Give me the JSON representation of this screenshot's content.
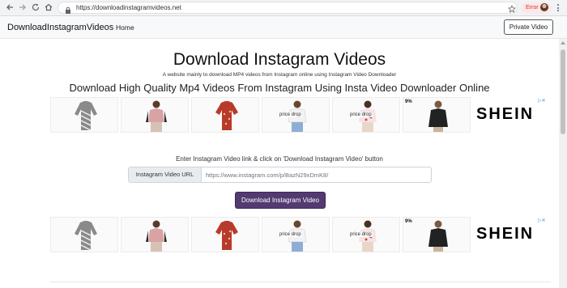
{
  "browser": {
    "url": "https://downloadinstagramvideos.net",
    "error_label": "Error",
    "icons": [
      "back-icon",
      "forward-icon",
      "reload-icon",
      "home-icon",
      "lock-icon",
      "star-icon",
      "menu-icon"
    ]
  },
  "navbar": {
    "brand": "DownloadInstagramVideos",
    "home": "Home",
    "private_video": "Private Video"
  },
  "hero": {
    "title": "Download Instagram Videos",
    "subtitle": "A website mainly to download MP4 videos from Instagram online using Instagram Video Downloader",
    "heading": "Download High Quality Mp4 Videos From Instagram Using Insta Video Downloader Online"
  },
  "ads": {
    "brand": "SHEIN",
    "price_drop": "price drop",
    "discount": "9%",
    "products": [
      {
        "name": "striped-blouse",
        "color": "#6b6b6b",
        "tag": false
      },
      {
        "name": "model-pink-top",
        "color": "#d9a3a3",
        "tag": false
      },
      {
        "name": "red-floral-blouse",
        "color": "#b83a2c",
        "tag": false
      },
      {
        "name": "white-top-model",
        "color": "#e8e8e8",
        "tag": true
      },
      {
        "name": "floral-top-model",
        "color": "#e7c2c2",
        "tag": true
      },
      {
        "name": "black-blouse-model",
        "color": "#2a2a2a",
        "tag": false,
        "pct": true
      }
    ]
  },
  "form": {
    "prompt": "Enter Instagram Video link & click on 'Download Instagram Video' button",
    "addon_label": "Instagram Video URL",
    "placeholder": "https://www.instagram.com/p/BazN29xDmK8/",
    "button": "Download Instagram Video"
  },
  "colors": {
    "primary_button": "#533a71",
    "error": "#d93025"
  }
}
